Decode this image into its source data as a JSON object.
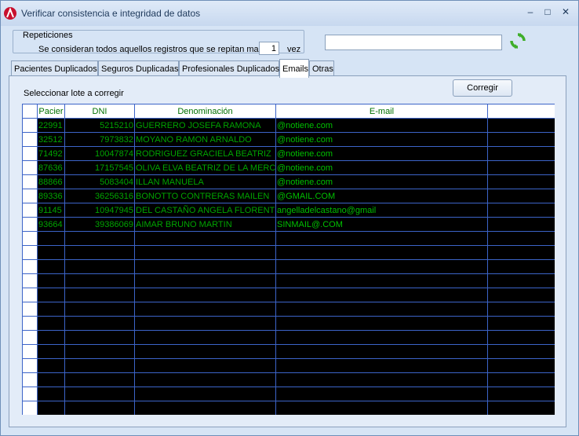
{
  "window": {
    "title": "Verificar consistencia e integridad de datos"
  },
  "repeticiones": {
    "legend": "Repeticiones",
    "text": "Se consideran todos aquellos registros que se repitan mas de",
    "value": "1",
    "unit": "vez"
  },
  "search": {
    "value": ""
  },
  "tabs": [
    {
      "label": "Pacientes Duplicados"
    },
    {
      "label": "Seguros Duplicadas"
    },
    {
      "label": "Profesionales Duplicados"
    },
    {
      "label": "Emails"
    },
    {
      "label": "Otras"
    }
  ],
  "panel": {
    "select_label": "Seleccionar lote a corregir",
    "corregir_label": "Corregir"
  },
  "grid": {
    "headers": [
      "Pacier",
      "DNI",
      "Denominación",
      "E-mail",
      ""
    ],
    "rows": [
      {
        "paciente": "22991",
        "dni": "5215210",
        "denominacion": "GUERRERO JOSEFA RAMONA",
        "email": "@notiene.com"
      },
      {
        "paciente": "32512",
        "dni": "7973832",
        "denominacion": "MOYANO RAMON ARNALDO",
        "email": "@notiene.com"
      },
      {
        "paciente": "71492",
        "dni": "10047874",
        "denominacion": "RODRIGUEZ GRACIELA BEATRIZ",
        "email": "@notiene.com"
      },
      {
        "paciente": "87636",
        "dni": "17157545",
        "denominacion": "OLIVA ELVA BEATRIZ DE LA MERC",
        "email": "@notiene.com"
      },
      {
        "paciente": "88866",
        "dni": "5083404",
        "denominacion": "ILLAN MANUELA",
        "email": "@notiene.com"
      },
      {
        "paciente": "89336",
        "dni": "36256316",
        "denominacion": "BONOTTO CONTRERAS MAILEN",
        "email": "@GMAIL.COM"
      },
      {
        "paciente": "91145",
        "dni": "10947945",
        "denominacion": "DEL CASTAÑO ANGELA FLORENT",
        "email": "angelladelcastano@gmail"
      },
      {
        "paciente": "93664",
        "dni": "39386069",
        "denominacion": "AIMAR BRUNO MARTIN",
        "email": "SINMAIL@.COM"
      }
    ]
  }
}
